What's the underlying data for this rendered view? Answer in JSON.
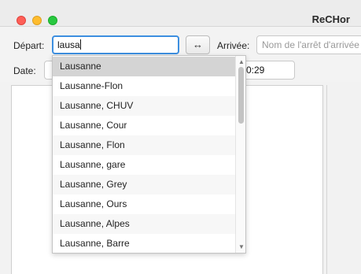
{
  "window": {
    "title": "ReCHor"
  },
  "form": {
    "depart_label": "Départ:",
    "depart_value": "lausa",
    "swap_label": "↔",
    "arrivee_label": "Arrivée:",
    "arrivee_placeholder": "Nom de l'arrêt d'arrivée",
    "date_label": "Date:",
    "time_value": "0:29"
  },
  "suggestions": {
    "selected_index": 0,
    "items": [
      "Lausanne",
      "Lausanne-Flon",
      "Lausanne, CHUV",
      "Lausanne, Cour",
      "Lausanne, Flon",
      "Lausanne, gare",
      "Lausanne, Grey",
      "Lausanne, Ours",
      "Lausanne, Alpes",
      "Lausanne, Barre"
    ]
  },
  "icons": {
    "scroll_up": "chevron-up-icon",
    "scroll_down": "chevron-down-icon",
    "swap": "swap-arrows-icon"
  }
}
